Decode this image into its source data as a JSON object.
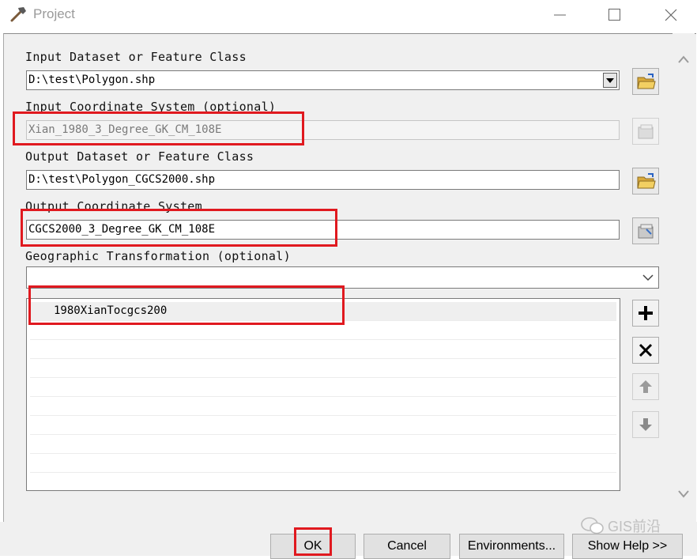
{
  "window": {
    "title": "Project",
    "icons": {
      "app": "hammer-icon",
      "minimize": "minimize-icon",
      "maximize": "maximize-icon",
      "close": "close-icon"
    }
  },
  "form": {
    "input_dataset": {
      "label": "Input Dataset or Feature Class",
      "value": "D:\\test\\Polygon.shp"
    },
    "input_coord": {
      "label": "Input Coordinate System (optional)",
      "value": "Xian_1980_3_Degree_GK_CM_108E"
    },
    "output_dataset": {
      "label": "Output Dataset or Feature Class",
      "value": "D:\\test\\Polygon_CGCS2000.shp"
    },
    "output_coord": {
      "label": "Output Coordinate System",
      "value": "CGCS2000_3_Degree_GK_CM_108E"
    },
    "geo_transform": {
      "label": "Geographic Transformation (optional)",
      "value": "",
      "items": [
        "1980XianTocgcs200"
      ]
    }
  },
  "side_buttons": [
    "add-icon",
    "remove-icon",
    "move-up-icon",
    "move-down-icon"
  ],
  "buttons": {
    "ok": "OK",
    "cancel": "Cancel",
    "environments": "Environments...",
    "show_help": "Show Help >>"
  },
  "watermark": "GIS前沿",
  "colors": {
    "highlight_red": "#e0191f",
    "panel_bg": "#f0f0f0"
  }
}
